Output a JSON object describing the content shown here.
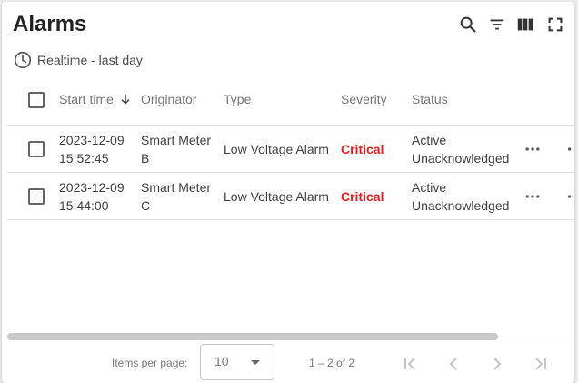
{
  "header": {
    "title": "Alarms",
    "tools": {
      "search": "search-icon",
      "filter": "filter-icon",
      "columns": "columns-icon",
      "fullscreen": "fullscreen-icon"
    }
  },
  "time_window": {
    "label": "Realtime - last day",
    "icon": "clock-icon"
  },
  "table": {
    "columns": [
      "Start time",
      "Originator",
      "Type",
      "Severity",
      "Status"
    ],
    "sort_icon": "arrow-down-icon",
    "rows": [
      {
        "start_date": "2023-12-09",
        "start_time": "15:52:45",
        "originator_1": "Smart Meter",
        "originator_2": "B",
        "type": "Low Voltage Alarm",
        "severity": "Critical",
        "status_1": "Active",
        "status_2": "Unacknowledged"
      },
      {
        "start_date": "2023-12-09",
        "start_time": "15:44:00",
        "originator_1": "Smart Meter",
        "originator_2": "C",
        "type": "Low Voltage Alarm",
        "severity": "Critical",
        "status_1": "Active",
        "status_2": "Unacknowledged"
      }
    ]
  },
  "paginator": {
    "items_per_page_label": "Items per page:",
    "items_per_page_value": "10",
    "range_label": "1 – 2 of 2",
    "icons": [
      "first-page-icon",
      "prev-page-icon",
      "next-page-icon",
      "last-page-icon"
    ]
  },
  "colors": {
    "critical": "#e41e1e",
    "text": "#222222",
    "muted": "#757575",
    "divider": "#dcdcdc",
    "disabled_icon": "#c4c4c4"
  }
}
